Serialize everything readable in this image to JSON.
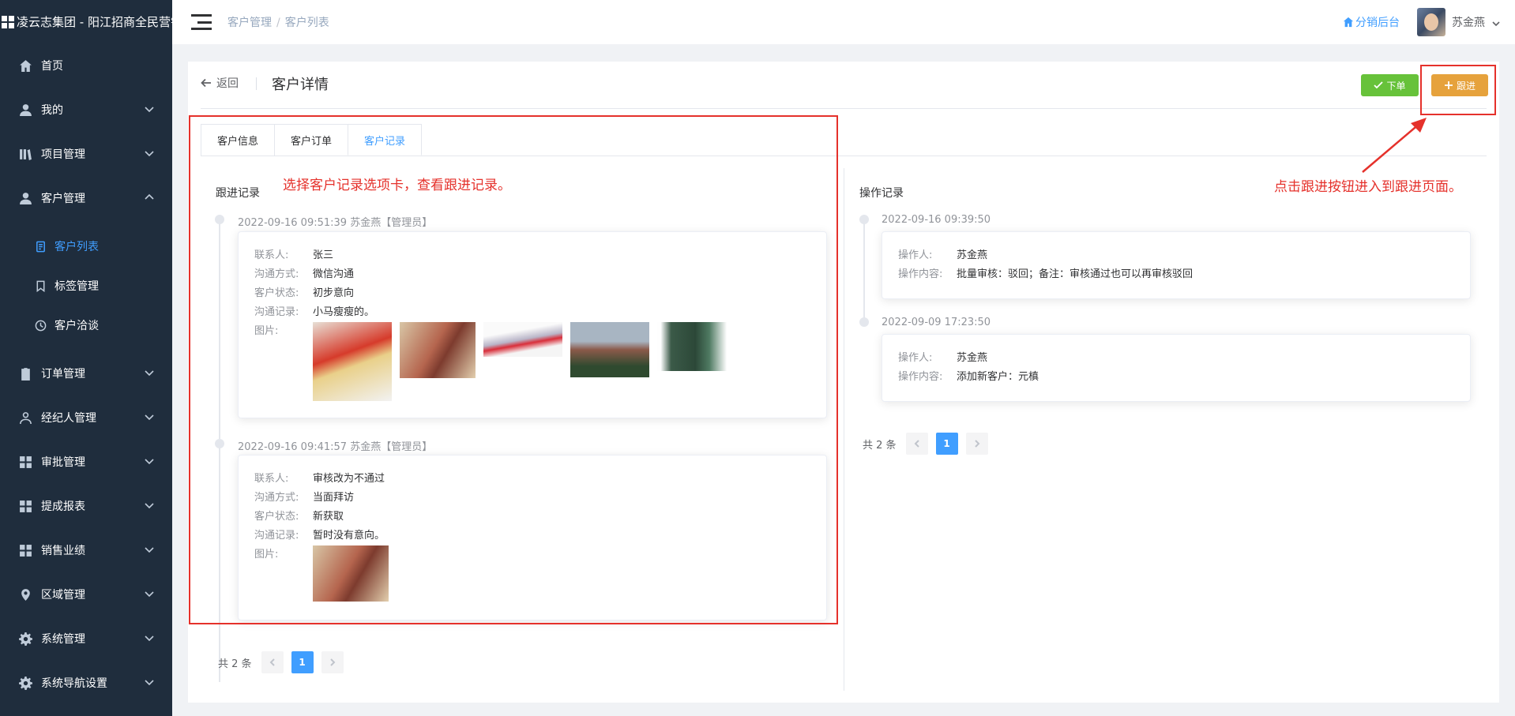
{
  "app": {
    "title": "凌云志集团 - 阳江招商全民营销"
  },
  "sidebar": {
    "items": [
      {
        "label": "首页",
        "icon": "home-icon"
      },
      {
        "label": "我的",
        "icon": "user-icon"
      },
      {
        "label": "项目管理",
        "icon": "project-icon"
      },
      {
        "label": "客户管理",
        "icon": "user-icon"
      },
      {
        "label": "订单管理",
        "icon": "clipboard-icon"
      },
      {
        "label": "经纪人管理",
        "icon": "person-outline-icon"
      },
      {
        "label": "审批管理",
        "icon": "grid-icon"
      },
      {
        "label": "提成报表",
        "icon": "grid-icon"
      },
      {
        "label": "销售业绩",
        "icon": "grid-icon"
      },
      {
        "label": "区域管理",
        "icon": "location-icon"
      },
      {
        "label": "系统管理",
        "icon": "gear-icon"
      },
      {
        "label": "系统导航设置",
        "icon": "gear-icon"
      }
    ],
    "sub_items": [
      {
        "label": "客户列表",
        "icon": "document-icon"
      },
      {
        "label": "标签管理",
        "icon": "bookmark-icon"
      },
      {
        "label": "客户洽谈",
        "icon": "clock-icon"
      }
    ]
  },
  "header": {
    "breadcrumb": [
      "客户管理",
      "客户列表"
    ],
    "breadcrumb_sep": "/",
    "dist_link": "分销后台",
    "user": "苏金燕"
  },
  "page": {
    "back": "返回",
    "title": "客户详情",
    "order_btn": "下单",
    "follow_btn": "跟进",
    "tabs": [
      "客户信息",
      "客户订单",
      "客户记录"
    ]
  },
  "follow": {
    "title": "跟进记录",
    "field_labels": {
      "contact": "联系人:",
      "method": "沟通方式:",
      "status": "客户状态:",
      "note": "沟通记录:",
      "images": "图片:"
    },
    "records": [
      {
        "time": "2022-09-16 09:51:39 苏金燕【管理员】",
        "contact": "张三",
        "method": "微信沟通",
        "status": "初步意向",
        "note": "小马瘦瘦的。",
        "images": [
          "snack-bag-image",
          "painting-image",
          "macbook-image",
          "campus-image",
          "phone-image"
        ]
      },
      {
        "time": "2022-09-16 09:41:57 苏金燕【管理员】",
        "contact": "审核改为不通过",
        "method": "当面拜访",
        "status": "新获取",
        "note": "暂时没有意向。",
        "images": [
          "painting-image"
        ]
      }
    ],
    "pager": {
      "total": "共 2 条",
      "page": "1"
    }
  },
  "ops": {
    "title": "操作记录",
    "field_labels": {
      "operator": "操作人:",
      "content": "操作内容:"
    },
    "records": [
      {
        "time": "2022-09-16 09:39:50",
        "operator": "苏金燕",
        "content": "批量审核：驳回；备注：审核通过也可以再审核驳回"
      },
      {
        "time": "2022-09-09 17:23:50",
        "operator": "苏金燕",
        "content": "添加新客户：元槙"
      }
    ],
    "pager": {
      "total": "共 2 条",
      "page": "1"
    }
  },
  "annotations": {
    "left": "选择客户记录选项卡，查看跟进记录。",
    "right": "点击跟进按钮进入到跟进页面。",
    "color": "#e5312b"
  },
  "colors": {
    "sidebar_bg": "#1f2d3d",
    "primary": "#409eff",
    "success": "#67c23a",
    "warning": "#e6a23c"
  }
}
